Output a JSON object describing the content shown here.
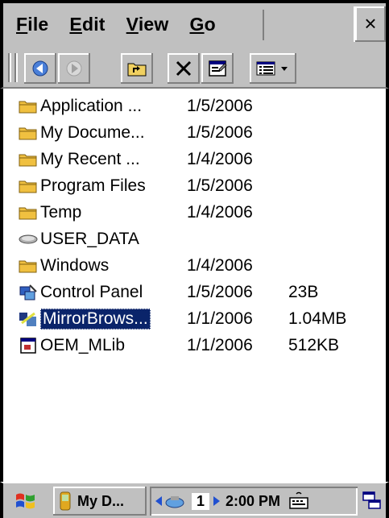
{
  "menubar": {
    "items": [
      {
        "label_first": "F",
        "label_rest": "ile"
      },
      {
        "label_first": "E",
        "label_rest": "dit"
      },
      {
        "label_first": "V",
        "label_rest": "iew"
      },
      {
        "label_first": "G",
        "label_rest": "o"
      }
    ],
    "close_label": "×"
  },
  "toolbar": {
    "buttons": [
      "back-icon",
      "forward-icon",
      "up-folder-icon",
      "delete-icon",
      "properties-icon",
      "view-menu-icon"
    ]
  },
  "files": [
    {
      "icon": "folder-icon",
      "name": "Application ...",
      "date": "1/5/2006",
      "size": ""
    },
    {
      "icon": "folder-icon",
      "name": "My Docume...",
      "date": "1/5/2006",
      "size": ""
    },
    {
      "icon": "folder-icon",
      "name": "My Recent ...",
      "date": "1/4/2006",
      "size": ""
    },
    {
      "icon": "folder-icon",
      "name": "Program Files",
      "date": "1/5/2006",
      "size": ""
    },
    {
      "icon": "folder-icon",
      "name": "Temp",
      "date": "1/4/2006",
      "size": ""
    },
    {
      "icon": "drive-icon",
      "name": "USER_DATA",
      "date": "",
      "size": ""
    },
    {
      "icon": "folder-icon",
      "name": "Windows",
      "date": "1/4/2006",
      "size": ""
    },
    {
      "icon": "control-panel-icon",
      "name": "Control Panel",
      "date": "1/5/2006",
      "size": "23B"
    },
    {
      "icon": "mirror-app-icon",
      "name": "MirrorBrows...",
      "date": "1/1/2006",
      "size": "1.04MB",
      "selected": true
    },
    {
      "icon": "exe-icon",
      "name": "OEM_MLib",
      "date": "1/1/2006",
      "size": "512KB"
    }
  ],
  "taskbar": {
    "app_label": "My D...",
    "page_number": "1",
    "clock": "2:00 PM"
  },
  "colors": {
    "chrome": "#c0c0c0",
    "selection": "#0a246a",
    "folder": "#f0c040"
  }
}
